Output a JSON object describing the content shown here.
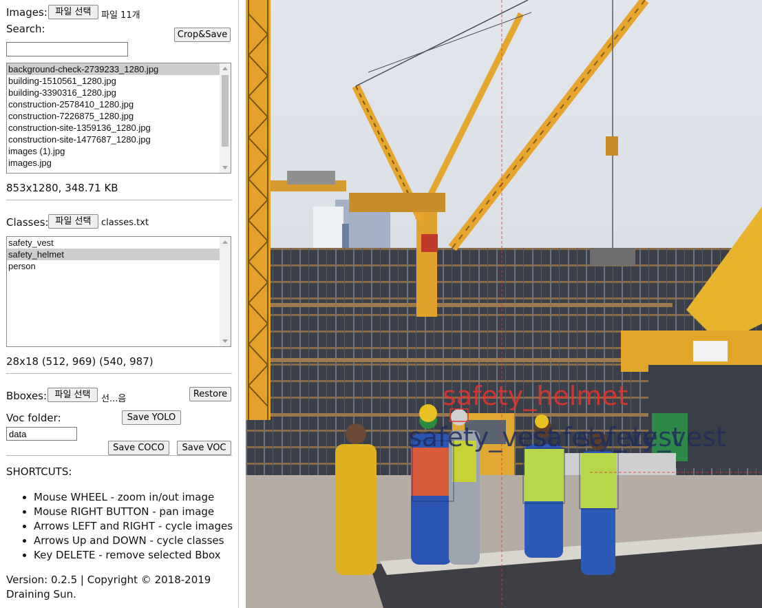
{
  "images": {
    "label": "Images:",
    "file_button": "파일 선택",
    "file_status": "파일 11개"
  },
  "search": {
    "label": "Search:",
    "value": "",
    "crop_save": "Crop&Save"
  },
  "image_list": {
    "items": [
      "background-check-2739233_1280.jpg",
      "building-1510561_1280.jpg",
      "building-3390316_1280.jpg",
      "construction-2578410_1280.jpg",
      "construction-7226875_1280.jpg",
      "construction-site-1359136_1280.jpg",
      "construction-site-1477687_1280.jpg",
      "images (1).jpg",
      "images.jpg"
    ],
    "selected_index": 0,
    "info": "853x1280, 348.71 KB"
  },
  "classes": {
    "label": "Classes:",
    "file_button": "파일 선택",
    "file_status": "classes.txt",
    "items": [
      "safety_vest",
      "safety_helmet",
      "person"
    ],
    "selected_index": 1,
    "bbox_info": "28x18 (512, 969) (540, 987)"
  },
  "bboxes": {
    "label": "Bboxes:",
    "file_button": "파일 선택",
    "file_status": "선...음",
    "restore": "Restore"
  },
  "voc": {
    "label": "Voc folder:",
    "value": "data",
    "save_yolo": "Save YOLO",
    "save_coco": "Save COCO",
    "save_voc": "Save VOC"
  },
  "shortcuts": {
    "title": "SHORTCUTS:",
    "items": [
      "Mouse WHEEL - zoom in/out image",
      "Mouse RIGHT BUTTON - pan image",
      "Arrows LEFT and RIGHT - cycle images",
      "Arrows Up and DOWN - cycle classes",
      "Key DELETE - remove selected Bbox"
    ]
  },
  "footer": {
    "line1": "Version: 0.2.5 | Copyright © 2018-2019",
    "line2": "Draining Sun."
  },
  "canvas": {
    "labels": [
      "safety_helmet",
      "safety_vest",
      "safety_vest",
      "safety_vest"
    ],
    "colors": {
      "selected": "#e8342c",
      "normal": "#1f2d5c",
      "crosshair": "#e8342c"
    }
  }
}
